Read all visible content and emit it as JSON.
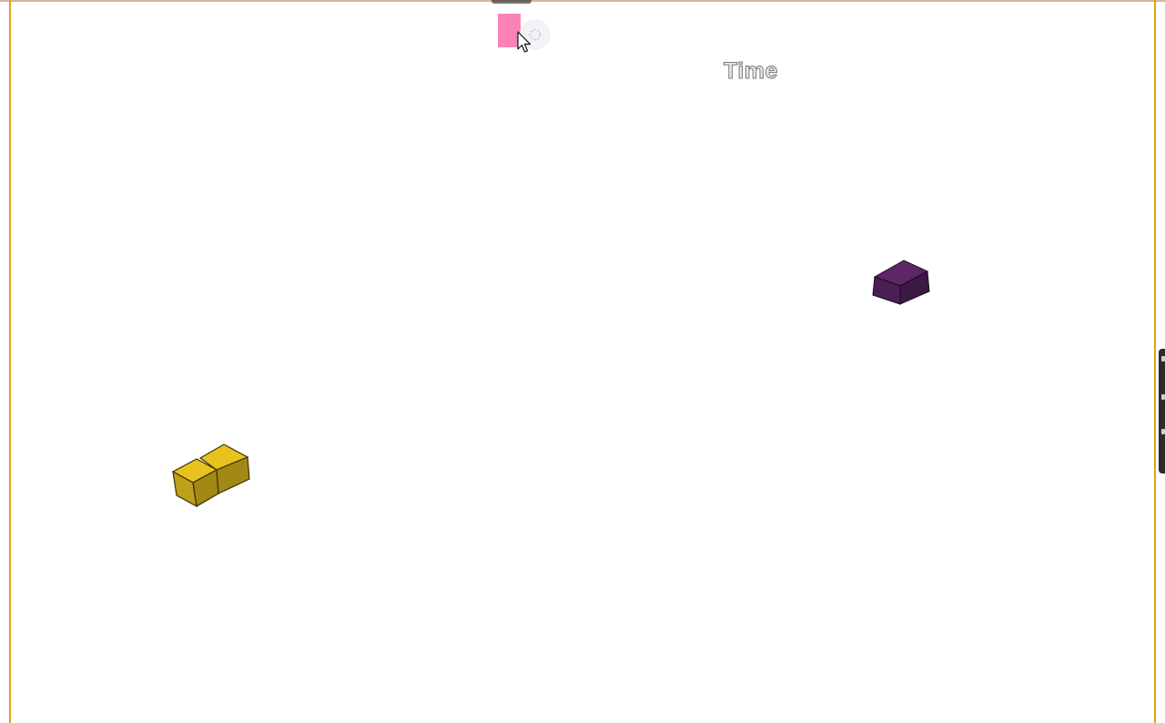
{
  "hud": {
    "time_label": "Time"
  },
  "colors": {
    "frame_border": "#e0a21b",
    "next_piece": "#fb82b4",
    "yellow_piece": "#e8c21e",
    "purple_piece": "#4a1f52"
  },
  "pieces": [
    {
      "name": "yellow-domino",
      "cells": 2,
      "color": "#e8c21e"
    },
    {
      "name": "purple-block",
      "cells": 1,
      "color": "#4a1f52"
    }
  ],
  "icons": {
    "cursor": "arrow-cursor-icon",
    "loading": "loading-spinner-icon"
  }
}
